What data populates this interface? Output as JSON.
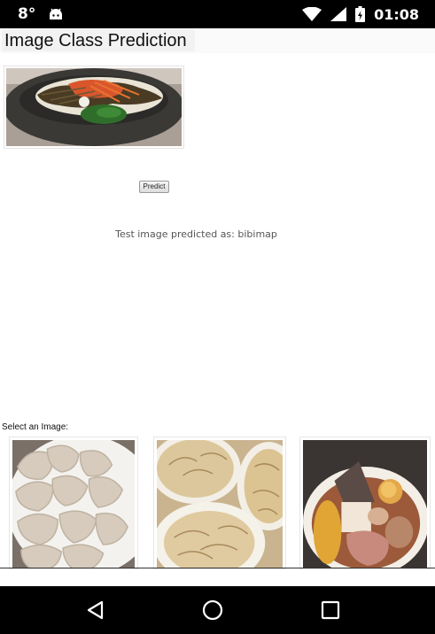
{
  "status_bar": {
    "temperature": "8°",
    "time": "01:08",
    "icons": [
      "android-icon",
      "wifi-icon",
      "cell-signal-icon",
      "battery-charging-icon"
    ]
  },
  "header": {
    "title": "Image Class Prediction"
  },
  "test_image": {
    "icon": "bibimbap-image",
    "colors": {
      "bowl": "#3b3936",
      "rice": "#e9e4d6",
      "kimchi": "#d9562c",
      "spinach": "#2f6e2a"
    }
  },
  "predict": {
    "label": "Predict"
  },
  "result": {
    "text": "Test image predicted as: bibimap"
  },
  "gallery": {
    "label": "Select an Image:",
    "items": [
      {
        "icon": "dumplings-image"
      },
      {
        "icon": "fried-dumplings-image"
      },
      {
        "icon": "oden-image"
      }
    ]
  },
  "nav_bar": {
    "icons": [
      "back-icon",
      "home-icon",
      "recents-icon"
    ]
  }
}
